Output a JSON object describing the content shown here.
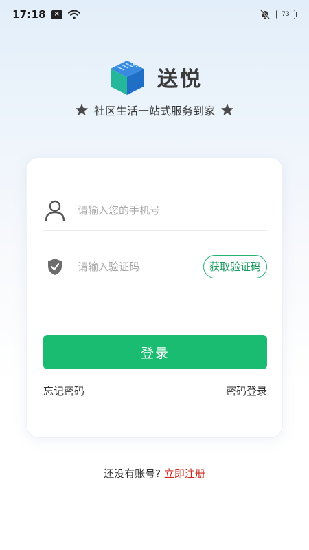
{
  "status_bar": {
    "time": "17:18",
    "notification_glyph": "×",
    "battery": "73"
  },
  "brand": {
    "name": "送悦",
    "logo_colors": {
      "top": "#3a8be0",
      "left": "#25b79a",
      "right": "#1f6fc7"
    }
  },
  "tagline": "社区生活一站式服务到家",
  "login_form": {
    "phone_placeholder": "请输入您的手机号",
    "code_placeholder": "请输入验证码",
    "get_code_label": "获取验证码",
    "submit_label": "登录",
    "forgot_password_label": "忘记密码",
    "password_login_label": "密码登录"
  },
  "footer": {
    "prompt": "还没有账号?",
    "register_label": "立即注册"
  },
  "colors": {
    "primary": "#19bc71",
    "register_link": "#cc2a1e"
  }
}
